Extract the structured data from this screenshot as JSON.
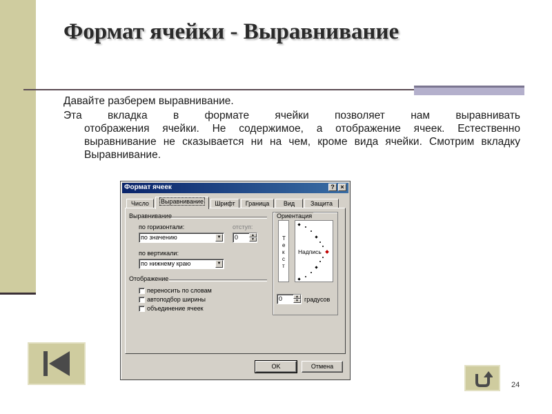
{
  "slide": {
    "title": "Формат ячейки - Выравнивание",
    "intro": "Давайте разберем выравнивание.",
    "para_first": "Эта вкладка в формате ячейки позволяет нам выравнивать",
    "para_rest": "отображения ячейки. Не содержимое, а отображение ячеек. Естественно выравнивание не сказывается ни на чем, кроме вида ячейки. Смотрим вкладку Выравнивание.",
    "page_number": "24",
    "colors": {
      "band": "#cfcc9f",
      "accent_bar": "#b4b0cc",
      "title_bar_start": "#0a246a",
      "title_bar_end": "#3a6ea5"
    }
  },
  "nav": {
    "back_icon": "skip-back-icon",
    "return_icon": "return-arrow-icon"
  },
  "dialog": {
    "title": "Формат ячеек",
    "help_label": "?",
    "close_label": "×",
    "tabs": [
      "Число",
      "Выравнивание",
      "Шрифт",
      "Граница",
      "Вид",
      "Защита"
    ],
    "active_tab": "Выравнивание",
    "alignment": {
      "group_label": "Выравнивание",
      "horizontal_label": "по горизонтали:",
      "horizontal_value": "по значению",
      "indent_label": "отступ:",
      "indent_value": "0",
      "vertical_label": "по вертикали:",
      "vertical_value": "по нижнему краю"
    },
    "display": {
      "group_label": "Отображение",
      "options": [
        "переносить по словам",
        "автоподбор ширины",
        "объединение ячеек"
      ]
    },
    "orientation": {
      "group_label": "Ориентация",
      "vertical_text": [
        "Т",
        "е",
        "к",
        "с",
        "т"
      ],
      "dial_label": "Надпись",
      "degrees_value": "0",
      "degrees_label": "градусов"
    },
    "ok_label": "OK",
    "cancel_label": "Отмена"
  }
}
